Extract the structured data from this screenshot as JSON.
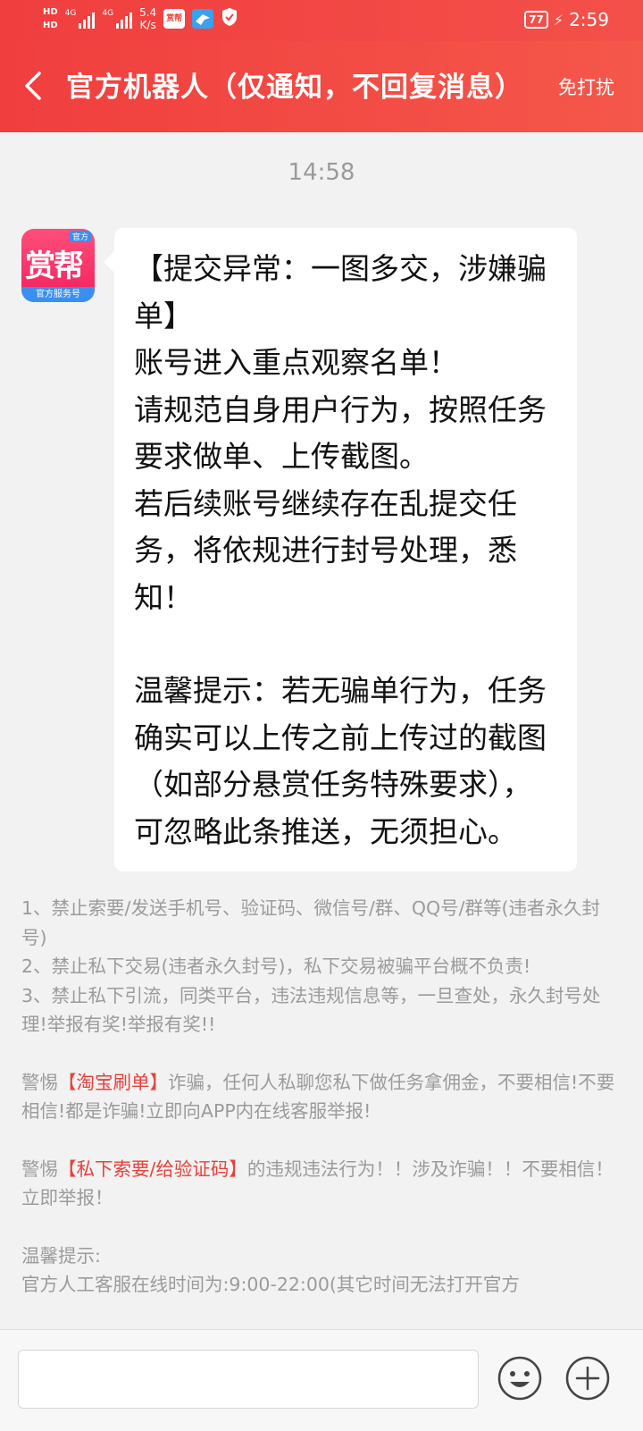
{
  "status_bar": {
    "hd_top": "HD",
    "hd_bottom": "HD",
    "network1": "4G",
    "network2": "4G",
    "speed_value": "5.4",
    "speed_unit": "K/s",
    "battery": "77",
    "time": "2:59",
    "app1_label": "赏帮"
  },
  "header": {
    "title": "官方机器人（仅通知，不回复消息）",
    "dnd_label": "免打扰"
  },
  "chat": {
    "timestamp": "14:58",
    "avatar": {
      "brand": "赏帮",
      "corner": "官方",
      "footer": "官方服务号"
    },
    "message": {
      "para1": "【提交异常：一图多交，涉嫌骗单】",
      "para2": "账号进入重点观察名单！",
      "para3": "请规范自身用户行为，按照任务要求做单、上传截图。",
      "para4": "若后续账号继续存在乱提交任务，将依规进行封号处理，悉知！",
      "para5": "温馨提示：若无骗单行为，任务确实可以上传之前上传过的截图（如部分悬赏任务特殊要求），可忽略此条推送，无须担心。"
    }
  },
  "notice": {
    "rule1": "1、禁止索要/发送手机号、验证码、微信号/群、QQ号/群等(违者永久封号)",
    "rule2": "2、禁止私下交易(违者永久封号)，私下交易被骗平台概不负责!",
    "rule3": "3、禁止私下引流，同类平台，违法违规信息等，一旦查处，永久封号处理!举报有奖!举报有奖!!",
    "warn1_prefix": "警惕",
    "warn1_highlight": "【淘宝刷单】",
    "warn1_suffix": "诈骗，任何人私聊您私下做任务拿佣金，不要相信!不要相信!都是诈骗!立即向APP内在线客服举报!",
    "warn2_prefix": "警惕",
    "warn2_highlight": "【私下索要/给验证码】",
    "warn2_suffix": "的违规违法行为！！涉及诈骗！！不要相信！立即举报！",
    "tip_label": "温馨提示:",
    "tip_text": "官方人工客服在线时间为:9:00-22:00(其它时间无法打开官方"
  },
  "input_bar": {
    "placeholder": ""
  },
  "icons": {
    "back": "chevron-left-icon",
    "emoji": "emoji-icon",
    "plus": "plus-icon"
  },
  "colors": {
    "brand_red": "#f03e3e",
    "highlight": "#e8413c",
    "muted_text": "#9b9b9b",
    "background": "#f2f2f2"
  }
}
